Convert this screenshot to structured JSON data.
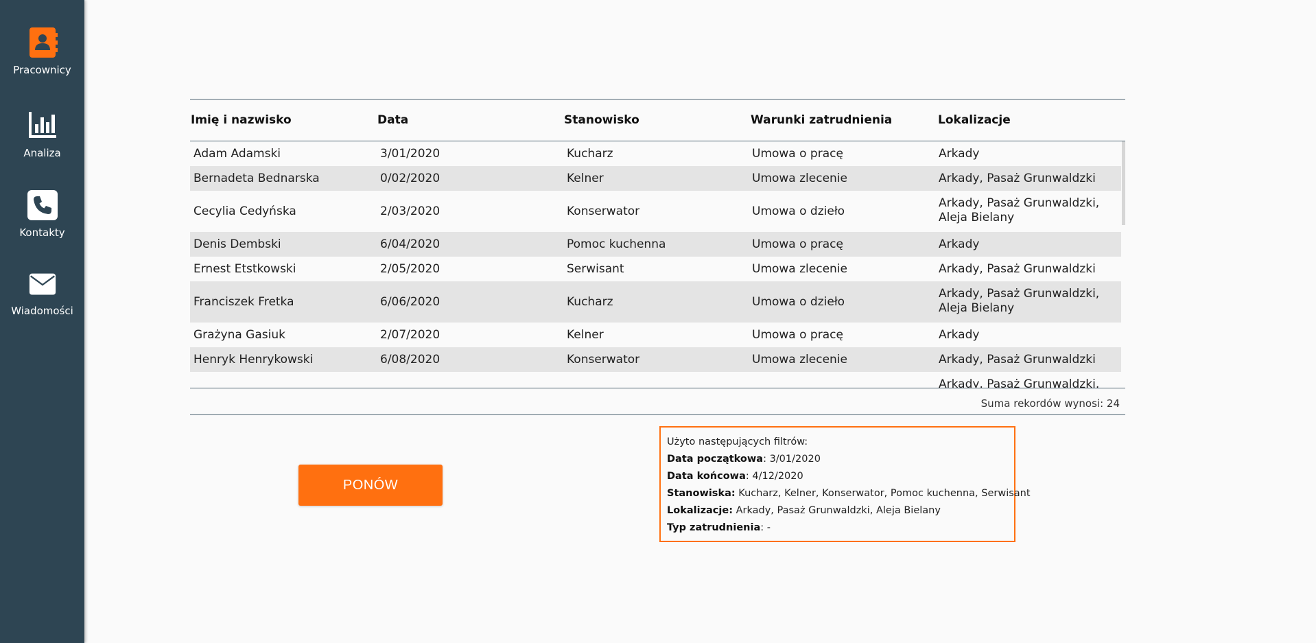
{
  "sidebar": {
    "items": [
      {
        "label": "Pracownicy",
        "icon": "address-book-icon"
      },
      {
        "label": "Analiza",
        "icon": "bar-chart-icon"
      },
      {
        "label": "Kontakty",
        "icon": "phone-icon"
      },
      {
        "label": "Wiadomości",
        "icon": "envelope-icon"
      }
    ]
  },
  "table": {
    "columns": [
      "Imię i nazwisko",
      "Data",
      "Stanowisko",
      "Warunki zatrudnienia",
      "Lokalizacje"
    ],
    "rows": [
      [
        "Adam Adamski",
        "3/01/2020",
        "Kucharz",
        "Umowa o pracę",
        "Arkady"
      ],
      [
        "Bernadeta Bednarska",
        "0/02/2020",
        "Kelner",
        "Umowa zlecenie",
        "Arkady, Pasaż Grunwaldzki"
      ],
      [
        "Cecylia Cedyńska",
        "2/03/2020",
        "Konserwator",
        "Umowa o dzieło",
        "Arkady, Pasaż Grunwaldzki, Aleja Bielany"
      ],
      [
        "Denis Dembski",
        "6/04/2020",
        "Pomoc kuchenna",
        "Umowa o pracę",
        "Arkady"
      ],
      [
        "Ernest Etstkowski",
        "2/05/2020",
        "Serwisant",
        "Umowa zlecenie",
        "Arkady, Pasaż Grunwaldzki"
      ],
      [
        "Franciszek Fretka",
        "6/06/2020",
        "Kucharz",
        "Umowa o dzieło",
        "Arkady, Pasaż Grunwaldzki, Aleja Bielany"
      ],
      [
        "Grażyna Gasiuk",
        "2/07/2020",
        "Kelner",
        "Umowa o pracę",
        "Arkady"
      ],
      [
        "Henryk Henrykowski",
        "6/08/2020",
        "Konserwator",
        "Umowa zlecenie",
        "Arkady, Pasaż Grunwaldzki"
      ],
      [
        "",
        "",
        "",
        "",
        "Arkady, Pasaż Grunwaldzki, Aleja"
      ]
    ],
    "total_label": "Suma rekordów wynosi: 24"
  },
  "retry_button": "PONÓW",
  "filters": {
    "heading": "Użyto następujących filtrów:",
    "start_date_label": "Data początkowa",
    "start_date_value": ": 3/01/2020",
    "end_date_label": "Data końcowa",
    "end_date_value": ": 4/12/2020",
    "positions_label": "Stanowiska:",
    "positions_value": " Kucharz, Kelner, Konserwator, Pomoc kuchenna, Serwisant",
    "locations_label": "Lokalizacje:",
    "locations_value": " Arkady, Pasaż Grunwaldzki, Aleja Bielany",
    "employment_label": "Typ zatrudnienia",
    "employment_value": ": -"
  },
  "colors": {
    "sidebar": "#2e4553",
    "accent": "#ff7010",
    "row_alt": "#e4e4e4"
  }
}
